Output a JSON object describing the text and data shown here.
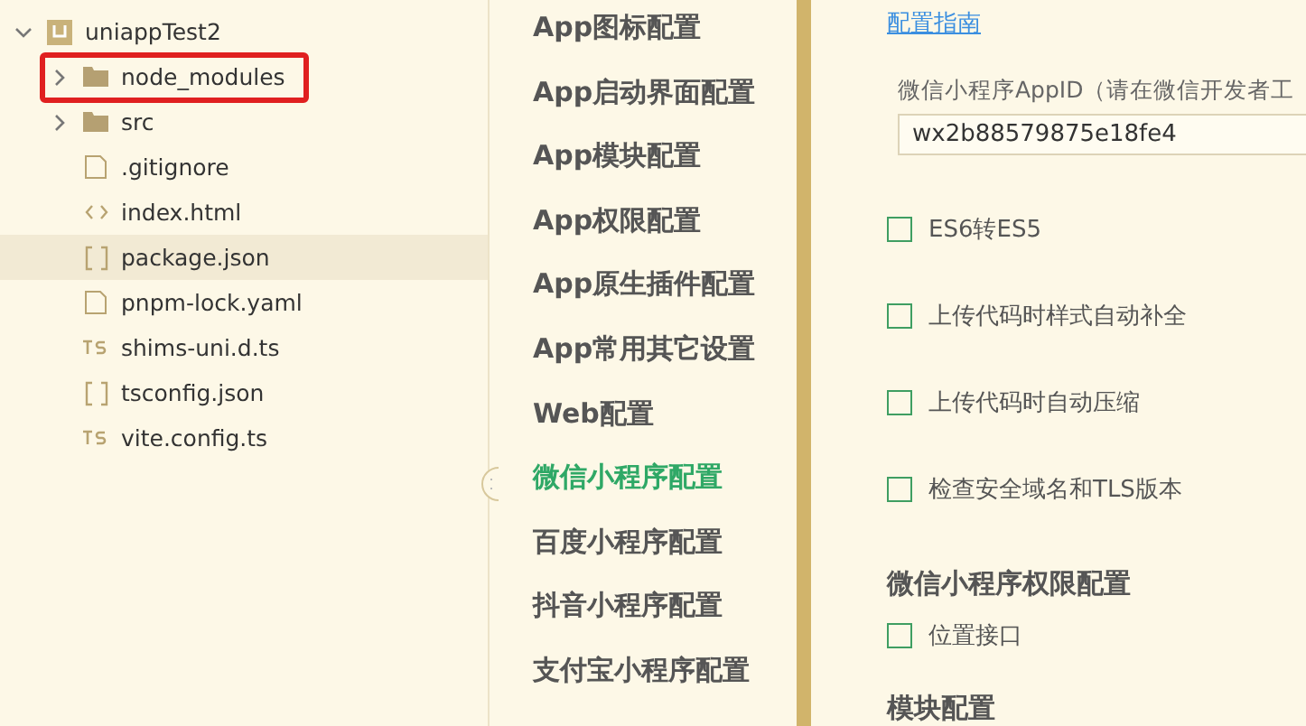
{
  "project": {
    "name": "uniappTest2",
    "expanded": true,
    "items": [
      {
        "name": "node_modules",
        "kind": "folder",
        "expanded": false,
        "outlined": true,
        "selected": false
      },
      {
        "name": "src",
        "kind": "folder",
        "expanded": false,
        "outlined": false,
        "selected": false
      },
      {
        "name": ".gitignore",
        "kind": "file",
        "outlined": false,
        "selected": false
      },
      {
        "name": "index.html",
        "kind": "html",
        "outlined": false,
        "selected": false
      },
      {
        "name": "package.json",
        "kind": "json",
        "outlined": false,
        "selected": true
      },
      {
        "name": "pnpm-lock.yaml",
        "kind": "file",
        "outlined": false,
        "selected": false
      },
      {
        "name": "shims-uni.d.ts",
        "kind": "ts",
        "outlined": false,
        "selected": false
      },
      {
        "name": "tsconfig.json",
        "kind": "json",
        "outlined": false,
        "selected": false
      },
      {
        "name": "vite.config.ts",
        "kind": "ts",
        "outlined": false,
        "selected": false
      }
    ]
  },
  "nav": [
    {
      "label": "App图标配置",
      "selected": false
    },
    {
      "label": "App启动界面配置",
      "selected": false
    },
    {
      "label": "App模块配置",
      "selected": false
    },
    {
      "label": "App权限配置",
      "selected": false
    },
    {
      "label": "App原生插件配置",
      "selected": false
    },
    {
      "label": "App常用其它设置",
      "selected": false
    },
    {
      "label": "Web配置",
      "selected": false
    },
    {
      "label": "微信小程序配置",
      "selected": true
    },
    {
      "label": "百度小程序配置",
      "selected": false
    },
    {
      "label": "抖音小程序配置",
      "selected": false
    },
    {
      "label": "支付宝小程序配置",
      "selected": false
    }
  ],
  "settings": {
    "guide_link": "配置指南",
    "appid_label": "微信小程序AppID（请在微信开发者工",
    "appid_value": "wx2b88579875e18fe4",
    "options": [
      {
        "label": "ES6转ES5",
        "checked": false
      },
      {
        "label": "上传代码时样式自动补全",
        "checked": false
      },
      {
        "label": "上传代码时自动压缩",
        "checked": false
      },
      {
        "label": "检查安全域名和TLS版本",
        "checked": false
      }
    ],
    "permissions_heading": "微信小程序权限配置",
    "permissions": [
      {
        "label": "位置接口",
        "checked": false
      }
    ],
    "modules_heading": "模块配置"
  }
}
